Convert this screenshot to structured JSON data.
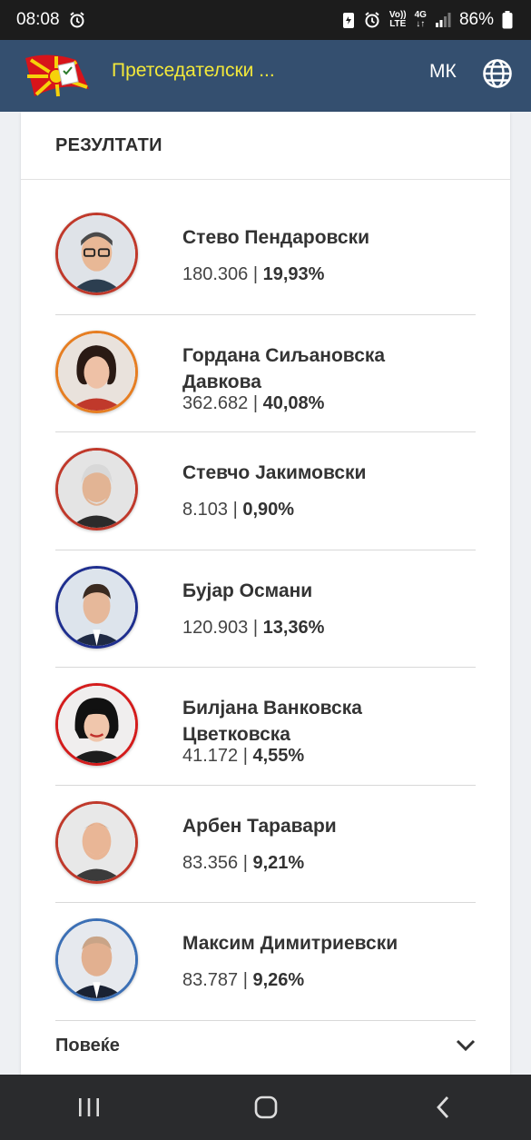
{
  "status_bar": {
    "time": "08:08",
    "network_top": "Vo))",
    "network_bottom": "LTE",
    "signal_type": "4G",
    "battery": "86%"
  },
  "app_bar": {
    "title": "Претседателски ...",
    "language": "МК",
    "logo_icon": "macedonia-flag-ballot-logo",
    "globe_icon": "globe-icon"
  },
  "results": {
    "title": "РЕЗУЛТАТИ",
    "candidates": [
      {
        "name": "Стево Пендаровски",
        "votes": "180.306",
        "percent": "19,93%",
        "ring_color": "#c0392b"
      },
      {
        "name": "Гордана Сиљановска Давкова",
        "votes": "362.682",
        "percent": "40,08%",
        "ring_color": "#e67e22"
      },
      {
        "name": "Стевчо Јакимовски",
        "votes": "8.103",
        "percent": "0,90%",
        "ring_color": "#c0392b"
      },
      {
        "name": "Бујар Османи",
        "votes": "120.903",
        "percent": "13,36%",
        "ring_color": "#1f2f8f"
      },
      {
        "name": "Билјана Ванковска Цветковска",
        "votes": "41.172",
        "percent": "4,55%",
        "ring_color": "#d41c1c"
      },
      {
        "name": "Арбен Таравари",
        "votes": "83.356",
        "percent": "9,21%",
        "ring_color": "#c0392b"
      },
      {
        "name": "Максим Димитриевски",
        "votes": "83.787",
        "percent": "9,26%",
        "ring_color": "#3b6fb5"
      }
    ],
    "more_label": "Повеќе"
  },
  "nav_bar": {
    "recents_icon": "recents-icon",
    "home_icon": "home-icon",
    "back_icon": "back-icon"
  }
}
